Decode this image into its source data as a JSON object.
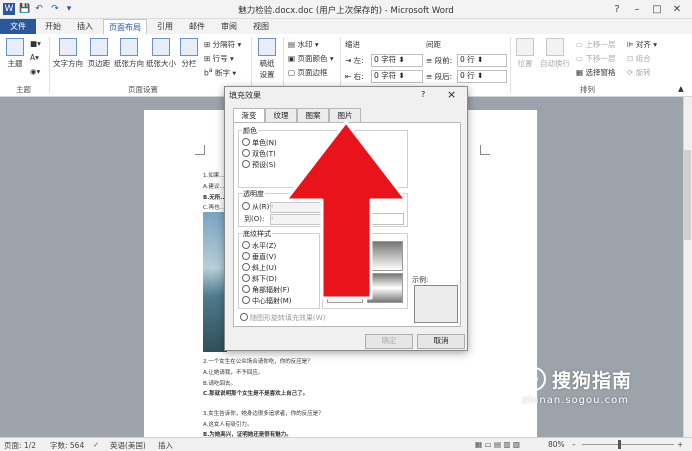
{
  "window": {
    "title": "魅力检验.docx.doc (用户上次保存的) - Microsoft Word",
    "qat": [
      "W",
      "💾",
      "↶",
      "↷",
      "▾"
    ]
  },
  "tabs": [
    "文件",
    "开始",
    "插入",
    "页面布局",
    "引用",
    "邮件",
    "审阅",
    "视图"
  ],
  "ribbon": {
    "theme": "主题",
    "themes_group": "主题",
    "text_direction": "文字方向",
    "margins": "页边距",
    "orientation": "纸张方向",
    "size": "纸张大小",
    "columns": "分栏",
    "breaks": "分隔符",
    "line_numbers": "行号",
    "hyphenation": "断字",
    "page_setup_group": "页面设置",
    "watermark": "水印",
    "page_color": "页面颜色",
    "page_borders": "页面边框",
    "manuscript": "稿纸设置",
    "indent_label": "缩进",
    "indent_left": "左: 0 字符",
    "indent_right": "右: 0 字符",
    "spacing_label": "间距",
    "spacing_before": "段前: 0 行",
    "spacing_after": "段后: 0 行",
    "position": "位置",
    "wrap": "自动换行",
    "bring_forward": "上移一层",
    "send_backward": "下移一层",
    "selection_pane": "选择窗格",
    "align": "对齐",
    "group": "组合",
    "rotate": "旋转",
    "arrange_group": "排列"
  },
  "document": {
    "lines": [
      "1.如果...",
      "A.建议...",
      "B.无所...",
      "C.再也...",
      "2.一个女生在公众场合请你吃，你的反应是？",
      "A.让她请我，不予回应。",
      "B.请吃回去。",
      "C.那就说明那个女生是不是喜欢上自己了。",
      "3.女生告诉你，她身边很多追求者，你的反应是？",
      "A.这女人有吸引力。",
      "B.为她高兴，证明她还是很有魅力。"
    ]
  },
  "dialog": {
    "title": "填充效果",
    "help": "?",
    "close": "×",
    "tabs": [
      "渐变",
      "纹理",
      "图案",
      "图片"
    ],
    "colors_label": "颜色",
    "color_options": [
      "单色(N)",
      "双色(T)",
      "预设(S)"
    ],
    "transparency_label": "透明度",
    "from_label": "从(R):",
    "to_label": "到(O):",
    "percent": "%",
    "shading_label": "底纹样式",
    "shading_options": [
      "水平(Z)",
      "垂直(V)",
      "斜上(U)",
      "斜下(D)",
      "角部辐射(F)",
      "中心辐射(M)"
    ],
    "variants_label": "变形(A)",
    "sample_label": "示例:",
    "rotate_checkbox": "随图形旋转填充效果(W)",
    "ok": "确定",
    "cancel": "取消"
  },
  "status": {
    "page": "页面: 1/2",
    "words": "字数: 564",
    "language": "英语(美国)",
    "insert": "插入",
    "zoom": "80%"
  },
  "watermark": {
    "brand": "搜狗指南",
    "url": "zhinan.sogou.com"
  },
  "colors": {
    "word_blue": "#2b579a",
    "arrow_red": "#e8131b"
  }
}
